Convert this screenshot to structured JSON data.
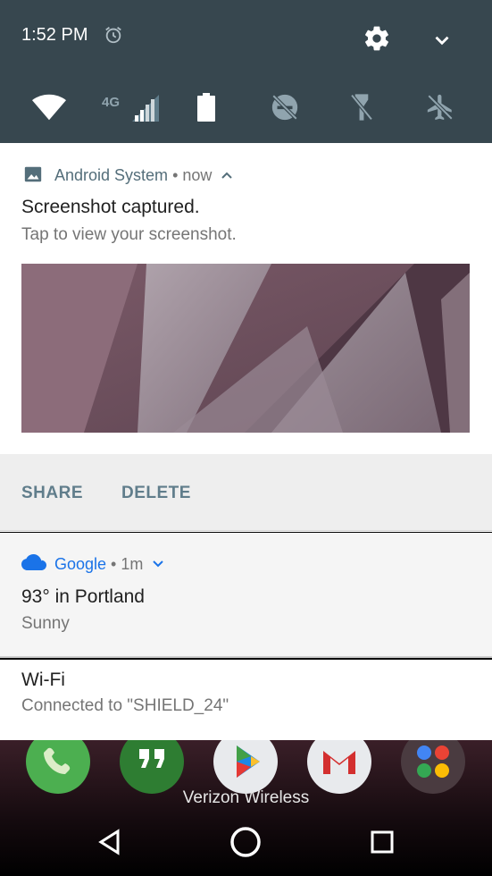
{
  "status_bar": {
    "time": "1:52 PM",
    "alarm_icon": "alarm-clock-icon",
    "settings_icon": "gear-icon",
    "expand_icon": "chevron-down-icon"
  },
  "quick_settings": [
    {
      "name": "wifi",
      "icon": "wifi-icon"
    },
    {
      "name": "cellular",
      "icon": "cell-signal-icon",
      "label": "4G"
    },
    {
      "name": "battery",
      "icon": "battery-icon"
    },
    {
      "name": "do-not-disturb",
      "icon": "dnd-off-icon"
    },
    {
      "name": "flashlight",
      "icon": "flashlight-off-icon"
    },
    {
      "name": "airplane-mode",
      "icon": "airplane-off-icon"
    }
  ],
  "notifications": {
    "screenshot": {
      "app_name": "Android System",
      "separator": " • ",
      "time": "now",
      "title": "Screenshot captured.",
      "text": "Tap to view your screenshot.",
      "actions": [
        "SHARE",
        "DELETE"
      ]
    },
    "weather": {
      "app_name": "Google",
      "separator": " • ",
      "time": "1m",
      "title": "93° in Portland",
      "text": "Sunny"
    },
    "wifi": {
      "title": "Wi-Fi",
      "text": "Connected to \"SHIELD_24\""
    }
  },
  "home": {
    "carrier": "Verizon Wireless",
    "dock": [
      "phone-icon",
      "hangouts-icon",
      "play-store-icon",
      "gmail-icon",
      "google-apps-folder-icon"
    ]
  },
  "colors": {
    "shade": "#37474f",
    "accent_blue": "#1a73e8",
    "action_text": "#607d8b"
  }
}
